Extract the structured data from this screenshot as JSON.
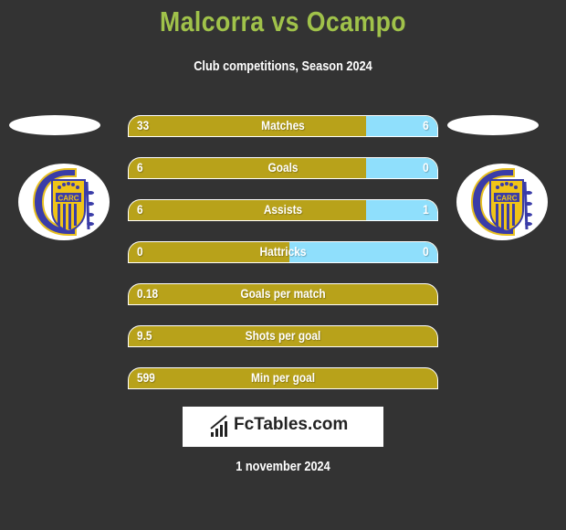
{
  "header": {
    "title": "Malcorra vs Ocampo",
    "subtitle": "Club competitions, Season 2024"
  },
  "colors": {
    "background": "#333333",
    "title": "#a0c24a",
    "left_bar": "#b8a21a",
    "right_bar": "#8fdffc"
  },
  "players": {
    "left": {
      "name": "Malcorra",
      "club_logo": "rosario-central-crest-icon"
    },
    "right": {
      "name": "Ocampo",
      "club_logo": "rosario-central-crest-icon"
    }
  },
  "stats": [
    {
      "label": "Matches",
      "left": "33",
      "right": "6",
      "left_share": 0.77
    },
    {
      "label": "Goals",
      "left": "6",
      "right": "0",
      "left_share": 0.77
    },
    {
      "label": "Assists",
      "left": "6",
      "right": "1",
      "left_share": 0.77
    },
    {
      "label": "Hattricks",
      "left": "0",
      "right": "0",
      "left_share": 0.52
    },
    {
      "label": "Goals per match",
      "left": "0.18",
      "right": "",
      "left_share": 1.0
    },
    {
      "label": "Shots per goal",
      "left": "9.5",
      "right": "",
      "left_share": 1.0
    },
    {
      "label": "Min per goal",
      "left": "599",
      "right": "",
      "left_share": 1.0
    }
  ],
  "footer": {
    "brand": "FcTables.com",
    "date": "1 november 2024"
  }
}
